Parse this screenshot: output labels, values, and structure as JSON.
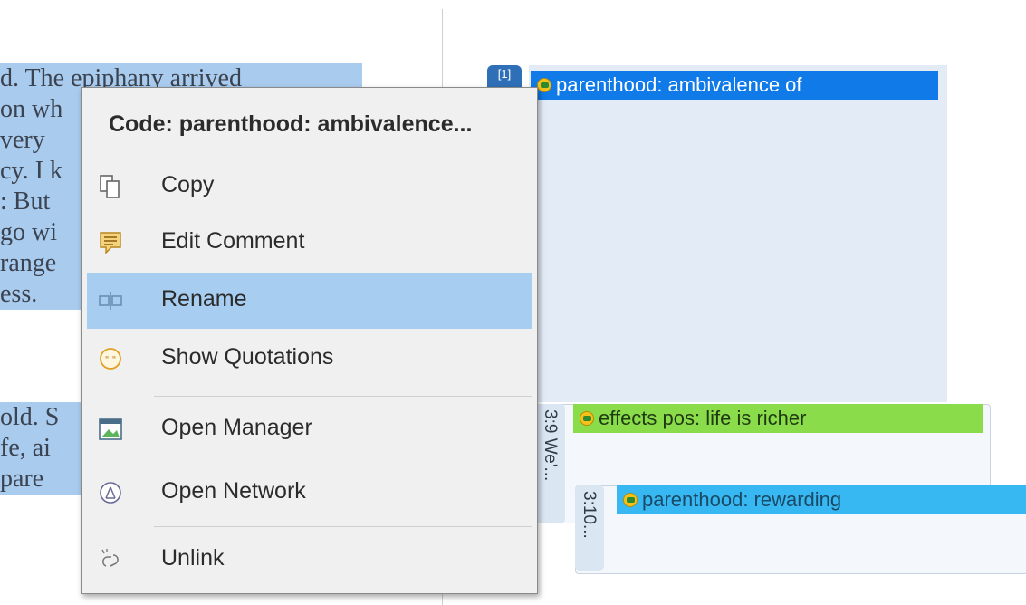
{
  "document": {
    "lines": [
      "d. The epiphany arrived",
      "on wh",
      "very",
      "cy. I k",
      ": But",
      "go wi",
      "range",
      "ess.",
      "old. S",
      "fe, ai",
      "pare"
    ]
  },
  "margin": {
    "codes": [
      {
        "label": "parenthood: ambivalence of",
        "color": "#0f7ae8"
      },
      {
        "label": "effects pos: life is richer",
        "color": "#8bdc4a"
      },
      {
        "label": "parenthood: rewarding",
        "color": "#38b8f2"
      }
    ],
    "quotations": [
      {
        "label": "3:9 We'..."
      },
      {
        "label": "3:10..."
      }
    ],
    "badge": "[1]"
  },
  "context_menu": {
    "title": "Code: parenthood: ambivalence...",
    "items": [
      {
        "label": "Copy",
        "icon": "copy-icon"
      },
      {
        "label": "Edit Comment",
        "icon": "comment-icon"
      },
      {
        "label": "Rename",
        "icon": "rename-icon",
        "highlighted": true
      },
      {
        "label": "Show Quotations",
        "icon": "quotations-icon"
      },
      {
        "label": "Open Manager",
        "icon": "manager-icon"
      },
      {
        "label": "Open Network",
        "icon": "network-icon"
      },
      {
        "label": "Unlink",
        "icon": "unlink-icon"
      }
    ]
  }
}
